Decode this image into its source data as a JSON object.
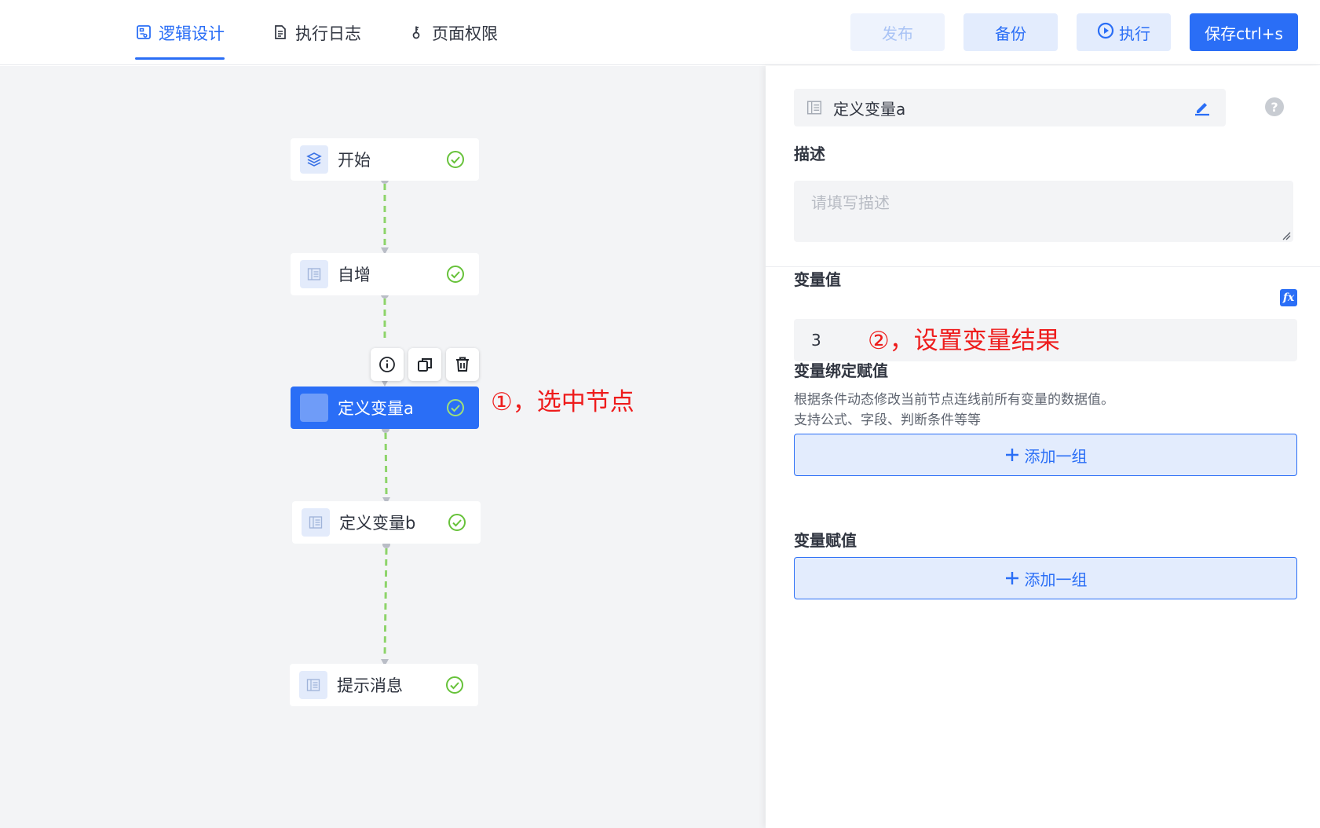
{
  "tabs": [
    {
      "label": "逻辑设计",
      "icon": "logic-design-icon",
      "active": true
    },
    {
      "label": "执行日志",
      "icon": "document-icon",
      "active": false
    },
    {
      "label": "页面权限",
      "icon": "key-icon",
      "active": false
    }
  ],
  "actions": {
    "publish": "发布",
    "backup": "备份",
    "execute": "执行",
    "save": "保存ctrl+s"
  },
  "flow": {
    "nodes": [
      {
        "label": "开始",
        "icon": "layers-icon",
        "status": "check-circle-icon"
      },
      {
        "label": "自增",
        "icon": "panel-icon",
        "status": "check-circle-icon"
      },
      {
        "label": "定义变量a",
        "icon": "panel-icon",
        "status": "check-circle-icon",
        "selected": true
      },
      {
        "label": "定义变量b",
        "icon": "panel-icon",
        "status": "check-circle-icon"
      },
      {
        "label": "提示消息",
        "icon": "panel-icon",
        "status": "check-circle-icon"
      }
    ],
    "node_tools": [
      "info-icon",
      "copy-icon",
      "trash-icon"
    ],
    "connector_color": "#8dd46a"
  },
  "annotations": {
    "step1": "①，选中节点",
    "step2": "②，设置变量结果"
  },
  "panel": {
    "node_name": "定义变量a",
    "description": {
      "title": "描述",
      "placeholder": "请填写描述"
    },
    "variable_value": {
      "title": "变量值",
      "value": "3",
      "fx_label": "fx"
    },
    "binding": {
      "title": "变量绑定赋值",
      "hint_line1": "根据条件动态修改当前节点连线前所有变量的数据值。",
      "hint_line2": "支持公式、字段、判断条件等等",
      "add_label": "添加一组"
    },
    "assignment": {
      "title": "变量赋值",
      "add_label": "添加一组"
    }
  },
  "colors": {
    "primary": "#2a6ef6",
    "annotation": "#ee1c1c",
    "success": "#67c23a",
    "canvas_bg": "#f3f4f6"
  }
}
